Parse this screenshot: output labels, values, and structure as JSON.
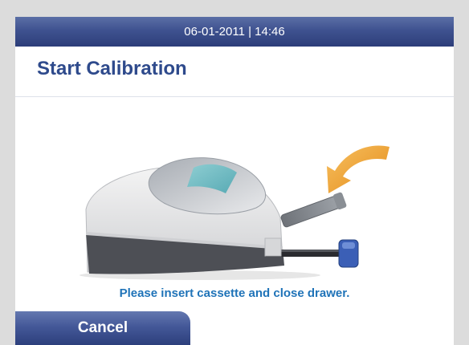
{
  "status_bar": {
    "datetime": "06-01-2011 | 14:46"
  },
  "header": {
    "title": "Start Calibration"
  },
  "illustration": {
    "icon": "analyzer-device-with-cassette-insert-arrow",
    "arrow_color": "#f0a030"
  },
  "instruction": {
    "text": "Please insert cassette and close drawer."
  },
  "footer": {
    "cancel_label": "Cancel"
  },
  "colors": {
    "bar_blue": "#3f5290",
    "title_blue": "#2e4a8c",
    "instruction_blue": "#1f73b8"
  }
}
